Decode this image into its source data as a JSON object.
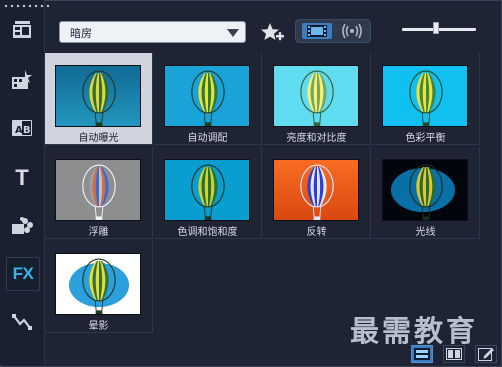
{
  "toolbar": {
    "items": [
      {
        "name": "media",
        "icon": "media-library-icon"
      },
      {
        "name": "instant-project",
        "icon": "instant-project-icon"
      },
      {
        "name": "transition",
        "icon": "transition-icon"
      },
      {
        "name": "title",
        "icon": "title-icon",
        "label": "T"
      },
      {
        "name": "graphic",
        "icon": "graphic-icon"
      },
      {
        "name": "filter",
        "icon": "fx-icon",
        "label": "FX",
        "active": true
      },
      {
        "name": "path",
        "icon": "motion-path-icon"
      }
    ]
  },
  "category": {
    "value": "暗房"
  },
  "slider": {
    "fraction": 0.46
  },
  "filters": [
    {
      "label": "自动曝光",
      "style": "auto-exposure",
      "selected": true
    },
    {
      "label": "自动调配",
      "style": "auto-adjust"
    },
    {
      "label": "亮度和对比度",
      "style": "brightness"
    },
    {
      "label": "色彩平衡",
      "style": "color-balance"
    },
    {
      "label": "浮雕",
      "style": "emboss"
    },
    {
      "label": "色调和饱和度",
      "style": "hue"
    },
    {
      "label": "反转",
      "style": "invert"
    },
    {
      "label": "光线",
      "style": "light"
    },
    {
      "label": "晕影",
      "style": "vignette"
    }
  ],
  "watermark": "最需教育",
  "view_buttons": [
    {
      "icon": "list-view-icon",
      "active": true
    },
    {
      "icon": "library-view-icon"
    },
    {
      "icon": "edit-icon"
    }
  ],
  "colors": {
    "accent": "#36b4f0",
    "selected_bg": "#cfd4df",
    "panel_bg": "#1e2433"
  }
}
